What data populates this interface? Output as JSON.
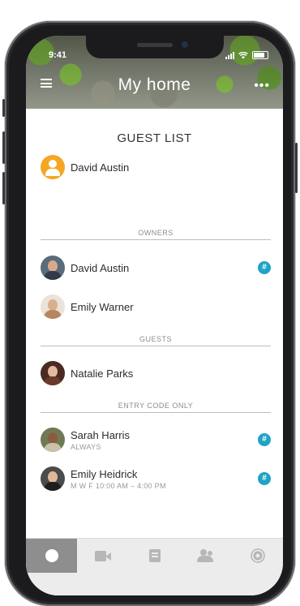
{
  "status_bar": {
    "time": "9:41"
  },
  "header": {
    "title": "My home"
  },
  "guest_list": {
    "title": "GUEST LIST",
    "primary": {
      "name": "David Austin"
    },
    "owners_label": "OWNERS",
    "owners": [
      {
        "name": "David Austin",
        "has_code": true
      },
      {
        "name": "Emily Warner",
        "has_code": false
      }
    ],
    "guests_label": "GUESTS",
    "guests": [
      {
        "name": "Natalie Parks",
        "has_code": false
      }
    ],
    "entry_label": "ENTRY CODE ONLY",
    "entry_code_only": [
      {
        "name": "Sarah Harris",
        "schedule": "ALWAYS",
        "has_code": true
      },
      {
        "name": "Emily Heidrick",
        "schedule": "M W F 10:00 AM – 4:00 PM",
        "has_code": true
      }
    ]
  },
  "icons": {
    "code_badge": "#"
  },
  "colors": {
    "accent": "#1fa3c4",
    "owner_avatar": "#f5a623",
    "active_tab": "#8e8e8e"
  },
  "tabbar": {
    "tabs": [
      {
        "icon": "home-dot-icon",
        "active": true
      },
      {
        "icon": "video-camera-icon",
        "active": false
      },
      {
        "icon": "list-icon",
        "active": false
      },
      {
        "icon": "people-icon",
        "active": false
      },
      {
        "icon": "gear-icon",
        "active": false
      }
    ]
  }
}
